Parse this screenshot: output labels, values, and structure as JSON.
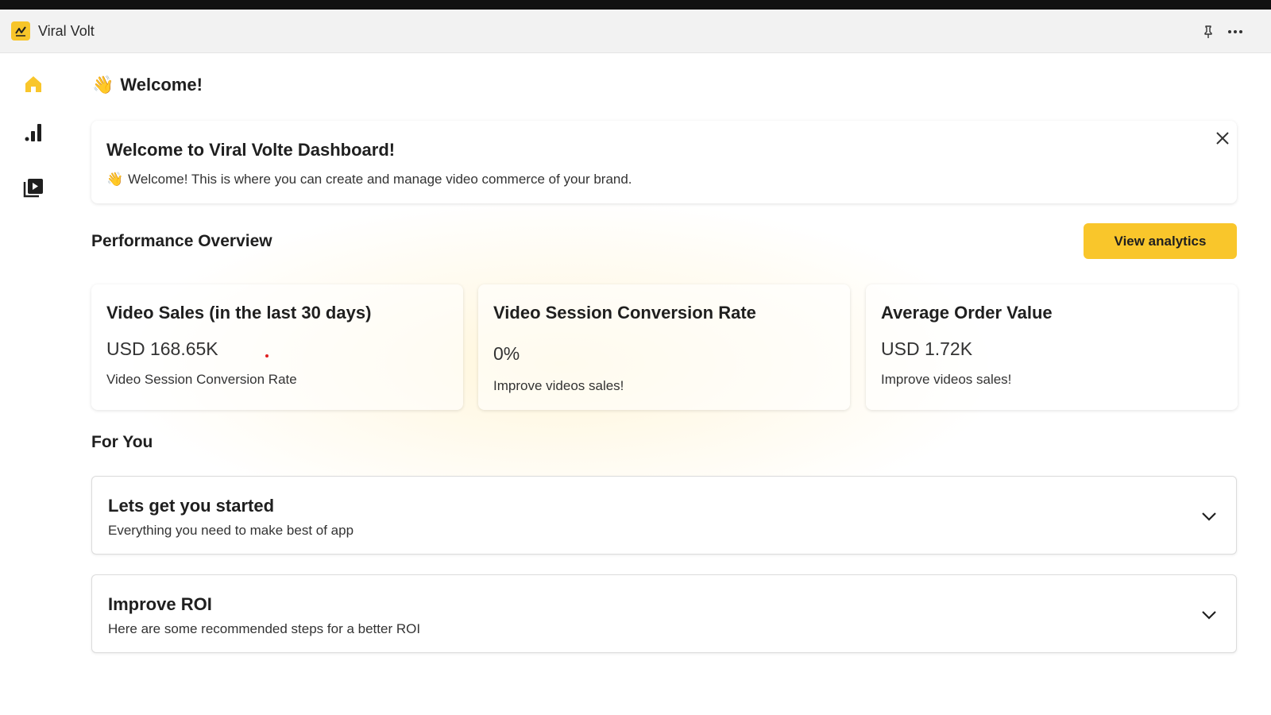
{
  "app": {
    "title": "Viral Volt",
    "accent": "#f9c62b"
  },
  "titlebar": {
    "icons": [
      "pin-icon",
      "more-options-icon"
    ]
  },
  "sidebar": {
    "items": [
      {
        "name": "home",
        "icon": "home-icon",
        "active": true
      },
      {
        "name": "analytics",
        "icon": "bar-chart-icon",
        "active": false
      },
      {
        "name": "videos",
        "icon": "video-library-icon",
        "active": false
      }
    ]
  },
  "main": {
    "welcome_emoji": "👋",
    "welcome_heading": "Welcome!",
    "banner": {
      "title": "Welcome to Viral Volte Dashboard!",
      "emoji": "👋",
      "text": "Welcome! This is where you can create and manage video commerce of your brand."
    },
    "performance": {
      "title": "Performance Overview",
      "cta_label": "View analytics",
      "cards": [
        {
          "title": "Video Sales (in the last 30 days)",
          "value": "USD 168.65K",
          "subtitle": "Video Session Conversion Rate"
        },
        {
          "title": "Video Session Conversion Rate",
          "value": "0%",
          "subtitle": "Improve videos sales!"
        },
        {
          "title": "Average Order Value",
          "value": "USD 1.72K",
          "subtitle": "Improve videos sales!"
        }
      ]
    },
    "for_you": {
      "title": "For You",
      "items": [
        {
          "title": "Lets get you started",
          "subtitle": "Everything you need to make best of app"
        },
        {
          "title": "Improve ROI",
          "subtitle": "Here are some recommended steps for a better ROI"
        }
      ]
    }
  }
}
